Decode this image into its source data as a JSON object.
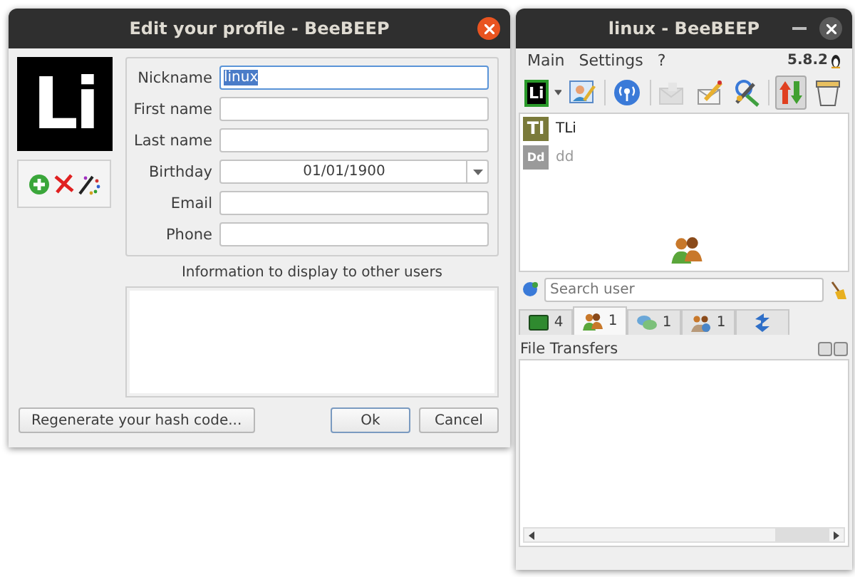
{
  "profile_dialog": {
    "title": "Edit your profile - BeeBEEP",
    "avatar": "Li",
    "fields": [
      {
        "label": "Nickname",
        "kind": "text",
        "value": "linux",
        "focused": true
      },
      {
        "label": "First name",
        "kind": "text",
        "focused": false
      },
      {
        "label": "Last name",
        "kind": "text",
        "focused": false
      },
      {
        "label": "Birthday",
        "kind": "date",
        "value": "01/01/1900"
      },
      {
        "label": "Email",
        "kind": "text",
        "focused": false
      },
      {
        "label": "Phone",
        "kind": "text",
        "focused": false
      }
    ],
    "info_label": "Information to display to other users",
    "buttons": [
      {
        "label": "Regenerate your hash code...",
        "default": false
      },
      {
        "label": "Ok",
        "default": true
      },
      {
        "label": "Cancel",
        "default": false
      }
    ]
  },
  "main_window": {
    "title": "linux - BeeBEEP",
    "menu": [
      "Main",
      "Settings",
      "?"
    ],
    "version": "5.8.2",
    "toolbar_avatar": "Li",
    "toolbar": [
      {
        "kind": "profile",
        "disabled": false,
        "pressed": false
      },
      {
        "kind": "network",
        "disabled": false,
        "pressed": false
      },
      {
        "kind": "mail",
        "disabled": true,
        "pressed": false
      },
      {
        "kind": "write",
        "disabled": false,
        "pressed": false
      },
      {
        "kind": "tools",
        "disabled": false,
        "pressed": false
      },
      {
        "kind": "transfers",
        "disabled": false,
        "pressed": true
      },
      {
        "kind": "trash",
        "disabled": false,
        "pressed": false
      }
    ],
    "users": [
      {
        "initials": "Tl",
        "name": "TLi",
        "online": true
      },
      {
        "initials": "Dd",
        "name": "dd",
        "online": false
      }
    ],
    "search": {
      "placeholder": "Search user"
    },
    "tabs": [
      {
        "kind": "computers",
        "count": "4",
        "selected": false
      },
      {
        "kind": "users",
        "count": "1",
        "selected": true
      },
      {
        "kind": "chats",
        "count": "1",
        "selected": false
      },
      {
        "kind": "groups",
        "count": "1",
        "selected": false
      },
      {
        "kind": "shares",
        "selected": false
      }
    ],
    "panel_title": "File Transfers"
  }
}
